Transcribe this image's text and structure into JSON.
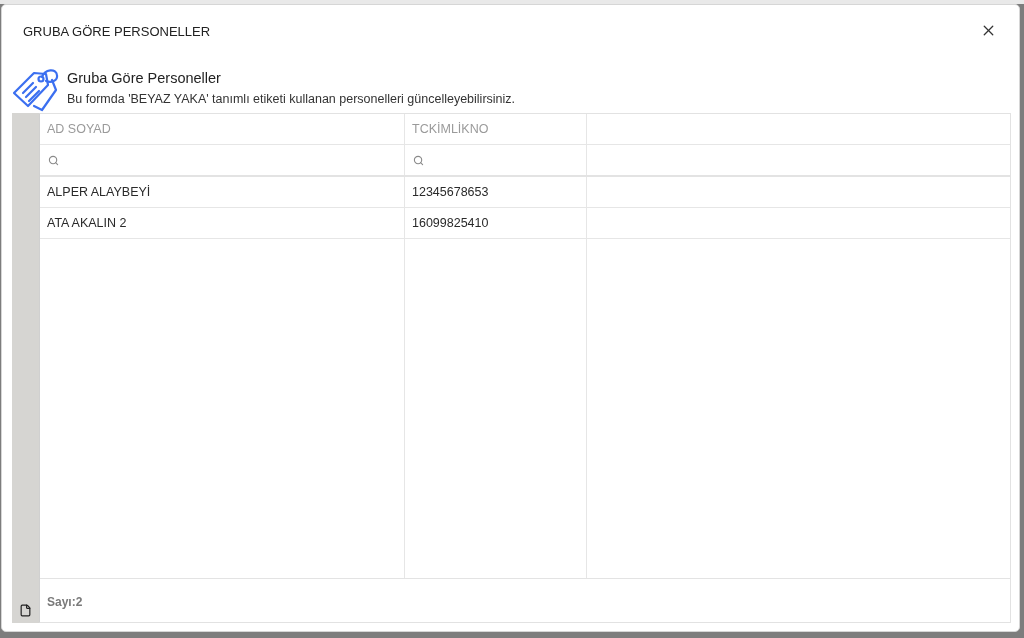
{
  "dialog": {
    "title": "GRUBA GÖRE PERSONELLER"
  },
  "header": {
    "title": "Gruba Göre Personeller",
    "description": "Bu formda 'BEYAZ YAKA' tanımlı etiketi kullanan personelleri güncelleyebilirsiniz."
  },
  "table": {
    "columns": [
      {
        "label": "AD SOYAD"
      },
      {
        "label": "TCKİMLİKNO"
      }
    ],
    "rows": [
      {
        "cells": [
          "ALPER ALAYBEYİ",
          "12345678653"
        ]
      },
      {
        "cells": [
          "ATA AKALIN 2",
          "16099825410"
        ]
      }
    ],
    "footer": {
      "count": "Sayı:2"
    }
  }
}
